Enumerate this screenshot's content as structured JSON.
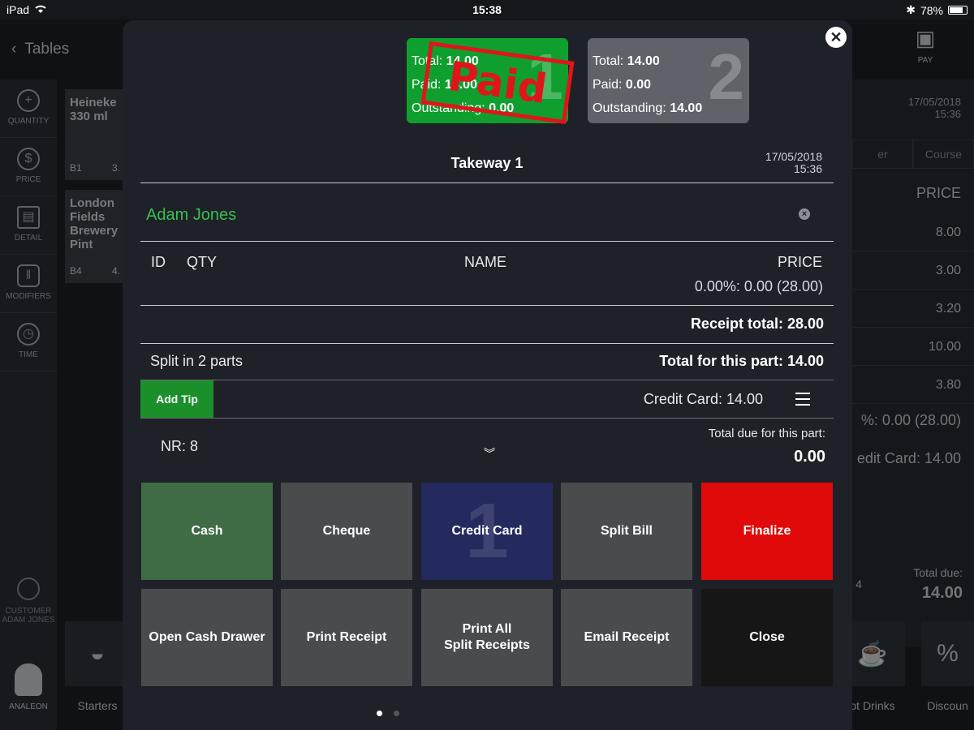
{
  "status_bar": {
    "device": "iPad",
    "time": "15:38",
    "battery": "78%"
  },
  "background": {
    "back_label": "Tables",
    "pay_label": "PAY",
    "sidebar": [
      "QUANTITY",
      "PRICE",
      "DETAIL",
      "MODIFIERS",
      "TIME"
    ],
    "sidebar_customer": [
      "CUSTOMER",
      "ADAM JONES"
    ],
    "sidebar_user": "ANALEON",
    "items": [
      {
        "name_lines": [
          "Heineke",
          "330 ml"
        ],
        "code": "B1",
        "price": "3."
      },
      {
        "name_lines": [
          "London",
          "Fields",
          "Brewery",
          "Pint"
        ],
        "code": "B4",
        "price": "4."
      }
    ],
    "right_panel": {
      "date": "17/05/2018",
      "time": "15:36",
      "tab_partial": "er",
      "tab_course": "Course",
      "price_header": "PRICE",
      "prices": [
        "8.00",
        "3.00",
        "3.20",
        "10.00",
        "3.80"
      ],
      "tax_line": "%: 0.00 (28.00)",
      "card_line": "edit Card: 14.00",
      "qty_partial": "4",
      "total_due_label": "Total due:",
      "total_due_value": "14.00"
    },
    "categories": [
      {
        "label": "Starters"
      },
      {
        "label": "ot Drinks"
      },
      {
        "label": "Discoun"
      }
    ]
  },
  "modal": {
    "parts": [
      {
        "total_label": "Total:",
        "total": "14.00",
        "paid_label": "Paid:",
        "paid": "14.00",
        "outstanding_label": "Outstanding:",
        "outstanding": "0.00",
        "number": "1",
        "stamp": "Paid"
      },
      {
        "total_label": "Total:",
        "total": "14.00",
        "paid_label": "Paid:",
        "paid": "0.00",
        "outstanding_label": "Outstanding:",
        "outstanding": "14.00",
        "number": "2"
      }
    ],
    "title": "Takeway 1",
    "date": "17/05/2018",
    "time": "15:36",
    "customer": "Adam Jones",
    "columns": {
      "id": "ID",
      "qty": "QTY",
      "name": "NAME",
      "price": "PRICE"
    },
    "tax_line": "0.00%: 0.00 (28.00)",
    "receipt_total": "Receipt total: 28.00",
    "split_label": "Split in 2 parts",
    "part_total": "Total for this part: 14.00",
    "add_tip": "Add Tip",
    "payment_line": "Credit Card: 14.00",
    "nr": "NR: 8",
    "due_label": "Total due for this part:",
    "due_value": "0.00",
    "buttons": {
      "cash": "Cash",
      "cheque": "Cheque",
      "credit_card": "Credit Card",
      "credit_card_count": "1",
      "split_bill": "Split Bill",
      "finalize": "Finalize",
      "open_drawer": "Open Cash Drawer",
      "print_receipt": "Print Receipt",
      "print_all_1": "Print All",
      "print_all_2": "Split Receipts",
      "email_receipt": "Email Receipt",
      "close": "Close"
    }
  },
  "colors": {
    "paid_green": "#0f9f2e",
    "unpaid_grey": "#5f6268",
    "stamp_red": "#e0151b",
    "customer_green": "#35c24c",
    "cash_green": "#3f6b45",
    "card_navy": "#242a5e",
    "finalize_red": "#e00a0a"
  }
}
